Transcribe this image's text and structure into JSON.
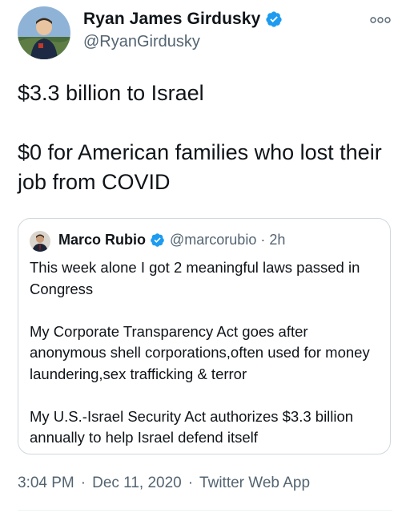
{
  "author": {
    "name": "Ryan James Girdusky",
    "handle": "@RyanGirdusky",
    "verified": true
  },
  "tweet": {
    "text": "$3.3 billion to Israel\n\n$0 for American families who lost their job from COVID"
  },
  "quoted_tweet": {
    "name": "Marco Rubio",
    "handle": "@marcorubio",
    "separator": "·",
    "time": "2h",
    "verified": true,
    "text": "This week alone I got 2 meaningful laws passed in Congress\n\nMy Corporate Transparency Act goes after anonymous shell corporations,often used for money laundering,sex trafficking & terror\n\nMy U.S.-Israel Security Act authorizes $3.3 billion annually to help Israel defend itself"
  },
  "meta": {
    "time": "3:04 PM",
    "date": "Dec 11, 2020",
    "source": "Twitter Web App",
    "separator": "·"
  },
  "colors": {
    "verified_badge": "#1d9bf0",
    "secondary_text": "#536471",
    "primary_text": "#0f1419",
    "border": "#cfd9de"
  },
  "icons": {
    "verified": "verified-badge-icon",
    "more": "more-options-icon"
  }
}
